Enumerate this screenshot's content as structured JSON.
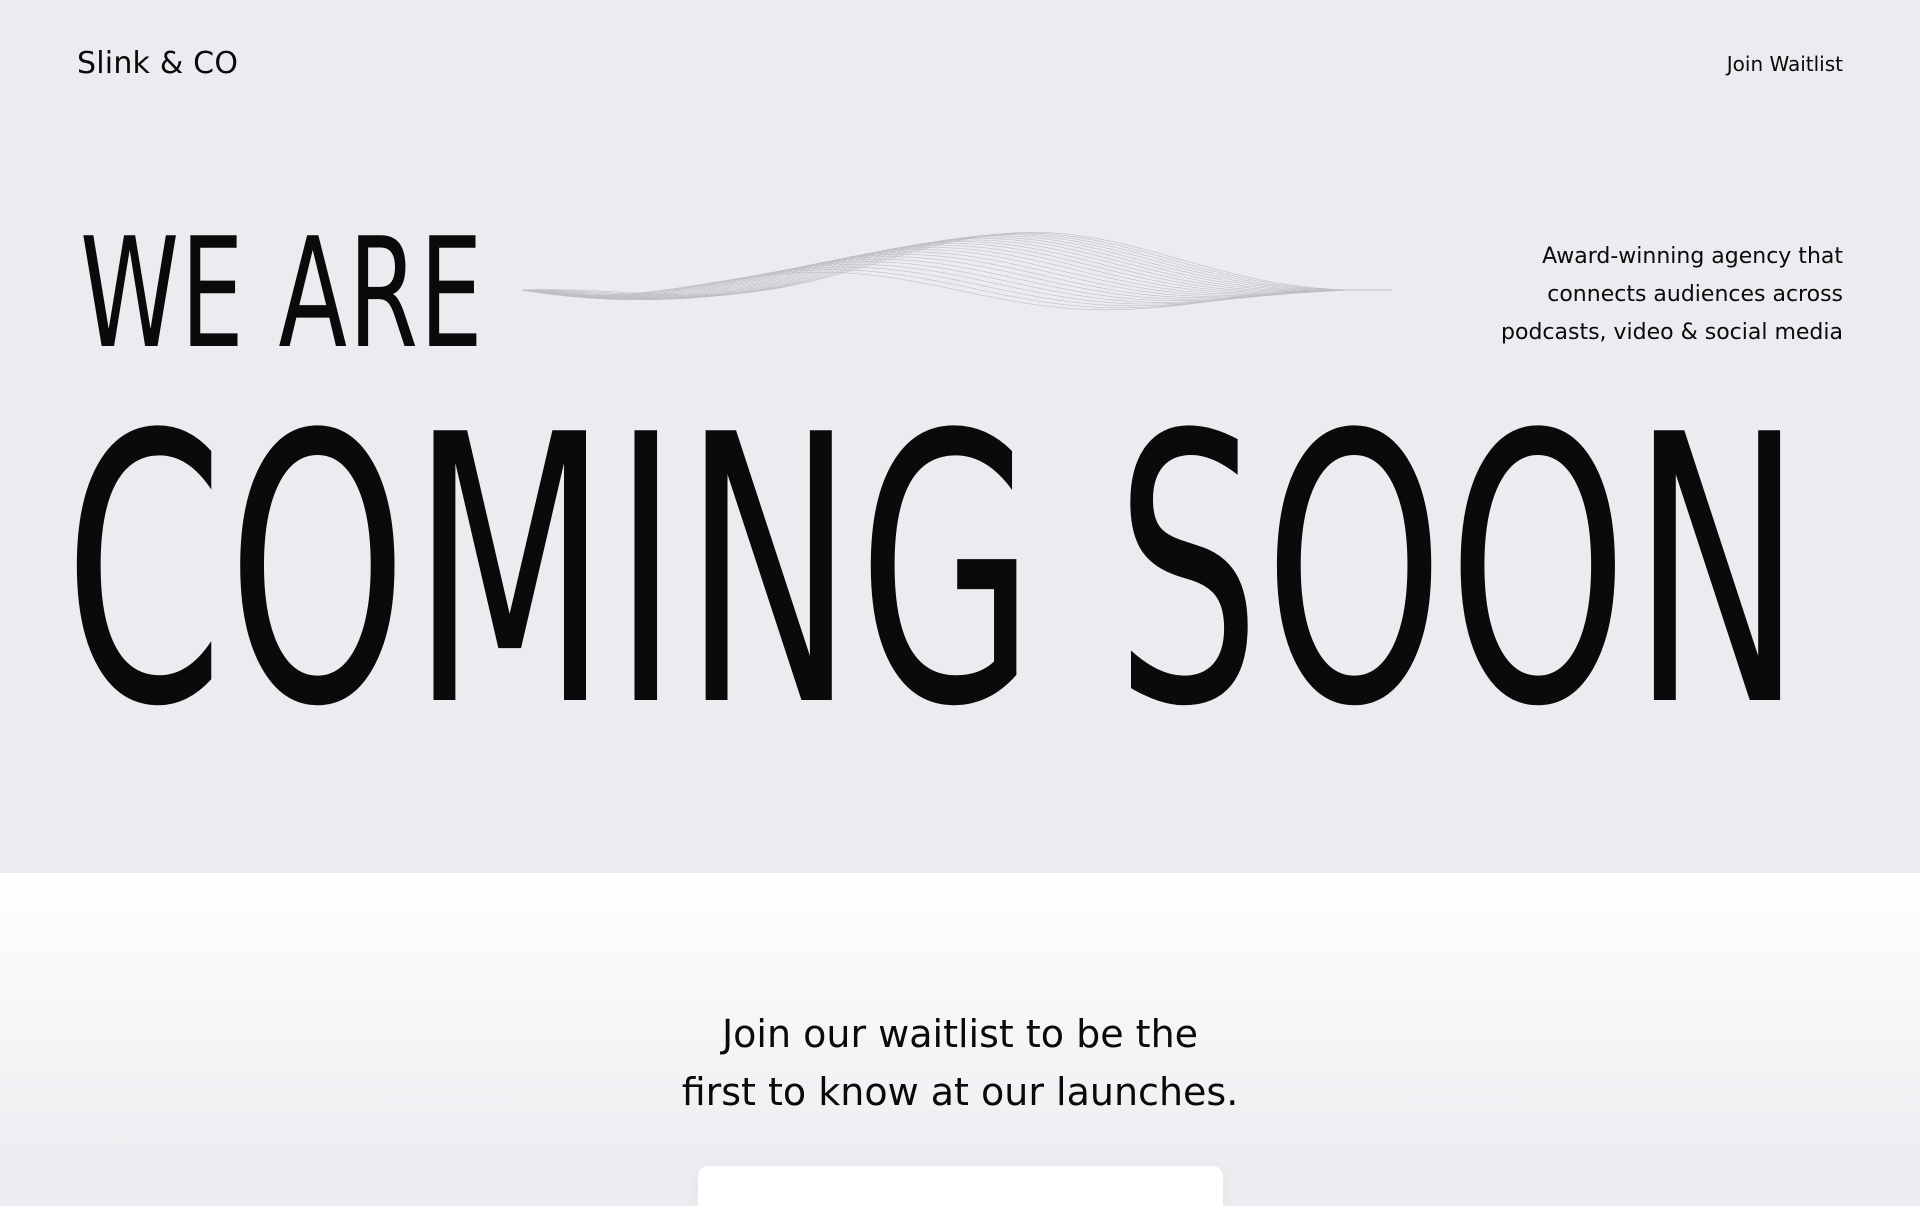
{
  "nav": {
    "logo": "Slink & CO",
    "cta_label": "Join Waitlist"
  },
  "hero": {
    "headline_small": "WE ARE",
    "headline_large": "COMING SOON",
    "tagline_line1": "Award-winning agency that",
    "tagline_line2": "connects audiences across",
    "tagline_line3": "podcasts, video & social media"
  },
  "waitlist": {
    "line1": "Join our waitlist to be the",
    "line2": "first to know at our launches."
  }
}
